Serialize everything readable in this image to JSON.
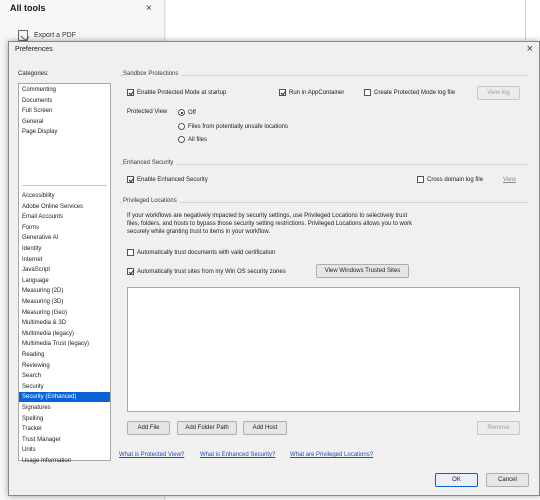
{
  "background": {
    "panel_title": "All tools",
    "close_glyph": "×",
    "item_label": "Export a PDF",
    "item_icon": "export-pdf-icon"
  },
  "dialog": {
    "title": "Preferences",
    "close_glyph": "×"
  },
  "categories": {
    "label": "Categories:",
    "top_items": [
      "Commenting",
      "Documents",
      "Full Screen",
      "General",
      "Page Display"
    ],
    "items": [
      "Accessibility",
      "Adobe Online Services",
      "Email Accounts",
      "Forms",
      "Generative AI",
      "Identity",
      "Internet",
      "JavaScript",
      "Language",
      "Measuring (2D)",
      "Measuring (3D)",
      "Measuring (Geo)",
      "Multimedia & 3D",
      "Multimedia (legacy)",
      "Multimedia Trust (legacy)",
      "Reading",
      "Reviewing",
      "Search",
      "Security",
      "Security (Enhanced)",
      "Signatures",
      "Spelling",
      "Tracker",
      "Trust Manager",
      "Units",
      "Usage Information"
    ],
    "selected": "Security (Enhanced)",
    "selection_color": "#0a64d8"
  },
  "sandbox": {
    "title": "Sandbox Protections",
    "enable_protected_mode": {
      "label": "Enable Protected Mode at startup",
      "checked": true
    },
    "run_in_appcontainer": {
      "label": "Run in AppContainer",
      "checked": true
    },
    "create_log": {
      "label": "Create Protected Mode log file",
      "checked": false
    },
    "view_log_button": "View log",
    "protected_view_label": "Protected View",
    "protected_view_options": [
      {
        "label": "Off",
        "selected": true
      },
      {
        "label": "Files from potentially unsafe locations",
        "selected": false
      },
      {
        "label": "All files",
        "selected": false
      }
    ]
  },
  "enhanced": {
    "title": "Enhanced Security",
    "enable": {
      "label": "Enable Enhanced Security",
      "checked": true
    },
    "cross_domain": {
      "label": "Cross domain log file",
      "checked": false
    },
    "view_link": "View"
  },
  "privileged": {
    "title": "Privileged Locations",
    "description": "If your workflows are negatively impacted by security settings, use Privileged Locations to selectively trust files, folders, and hosts to bypass those security setting restrictions. Privileged Locations allows you to work securely while granting trust to items in your workflow.",
    "trust_certified": {
      "label": "Automatically trust documents with valid certification",
      "checked": false
    },
    "trust_sites": {
      "label": "Automatically trust sites from my Win OS security zones",
      "checked": true
    },
    "view_trusted_sites_button": "View Windows Trusted Sites",
    "locations": [],
    "add_file_button": "Add File",
    "add_folder_button": "Add Folder Path",
    "add_host_button": "Add Host",
    "remove_button": "Remove"
  },
  "links": {
    "protected_view": "What is Protected View?",
    "enhanced_security": "What is Enhanced Security?",
    "privileged_locations": "What are Privileged Locations?"
  },
  "footer": {
    "ok_button": "OK",
    "cancel_button": "Cancel"
  }
}
